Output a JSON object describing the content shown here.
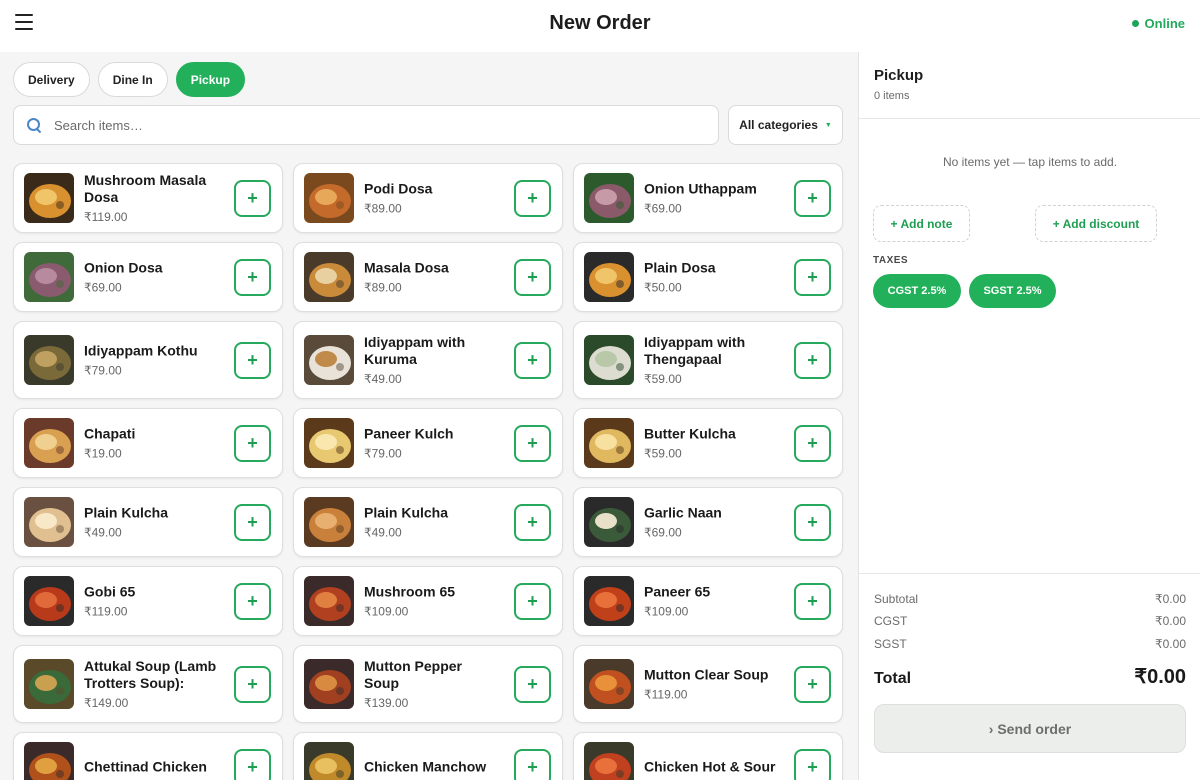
{
  "header": {
    "title": "New Order",
    "status": "Online",
    "status_color": "#1fa55a",
    "menu_icon": "hamburger-icon"
  },
  "order_types": [
    {
      "label": "Delivery",
      "active": false
    },
    {
      "label": "Dine In",
      "active": false
    },
    {
      "label": "Pickup",
      "active": true
    }
  ],
  "search": {
    "placeholder": "Search items…",
    "value": ""
  },
  "category_filter": {
    "selected": "All categories"
  },
  "accent_color": "#22b15a",
  "items": [
    {
      "name": "Mushroom Masala Dosa",
      "price": "₹119.00"
    },
    {
      "name": "Podi Dosa",
      "price": "₹89.00"
    },
    {
      "name": "Onion Uthappam",
      "price": "₹69.00"
    },
    {
      "name": "Onion Dosa",
      "price": "₹69.00"
    },
    {
      "name": "Masala Dosa",
      "price": "₹89.00"
    },
    {
      "name": "Plain Dosa",
      "price": "₹50.00"
    },
    {
      "name": "Idiyappam Kothu",
      "price": "₹79.00"
    },
    {
      "name": "Idiyappam with Kuruma",
      "price": "₹49.00"
    },
    {
      "name": "Idiyappam with Thengapaal",
      "price": "₹59.00"
    },
    {
      "name": "Chapati",
      "price": "₹19.00"
    },
    {
      "name": "Paneer Kulch",
      "price": "₹79.00"
    },
    {
      "name": "Butter Kulcha",
      "price": "₹59.00"
    },
    {
      "name": "Plain Kulcha",
      "price": "₹49.00"
    },
    {
      "name": "Plain Kulcha",
      "price": "₹49.00"
    },
    {
      "name": "Garlic Naan",
      "price": "₹69.00"
    },
    {
      "name": "Gobi 65",
      "price": "₹119.00"
    },
    {
      "name": "Mushroom 65",
      "price": "₹109.00"
    },
    {
      "name": "Paneer 65",
      "price": "₹109.00"
    },
    {
      "name": "Attukal Soup (Lamb Trotters Soup):",
      "price": "₹149.00"
    },
    {
      "name": "Mutton Pepper Soup",
      "price": "₹139.00"
    },
    {
      "name": "Mutton Clear Soup",
      "price": "₹119.00"
    },
    {
      "name": "Chettinad Chicken",
      "price": ""
    },
    {
      "name": "Chicken Manchow",
      "price": ""
    },
    {
      "name": "Chicken Hot & Sour",
      "price": ""
    }
  ],
  "add_button_symbol": "+",
  "order": {
    "type": "Pickup",
    "item_count": "0 items",
    "empty_message": "No items yet — tap items to add.",
    "add_note": "+  Add note",
    "add_discount": "+  Add discount",
    "taxes_label": "TAXES",
    "taxes": [
      "CGST 2.5%",
      "SGST 2.5%"
    ],
    "subtotal_label": "Subtotal",
    "subtotal": "₹0.00",
    "cgst_label": "CGST",
    "cgst": "₹0.00",
    "sgst_label": "SGST",
    "sgst": "₹0.00",
    "total_label": "Total",
    "total": "₹0.00",
    "send_label": "›  Send order"
  }
}
